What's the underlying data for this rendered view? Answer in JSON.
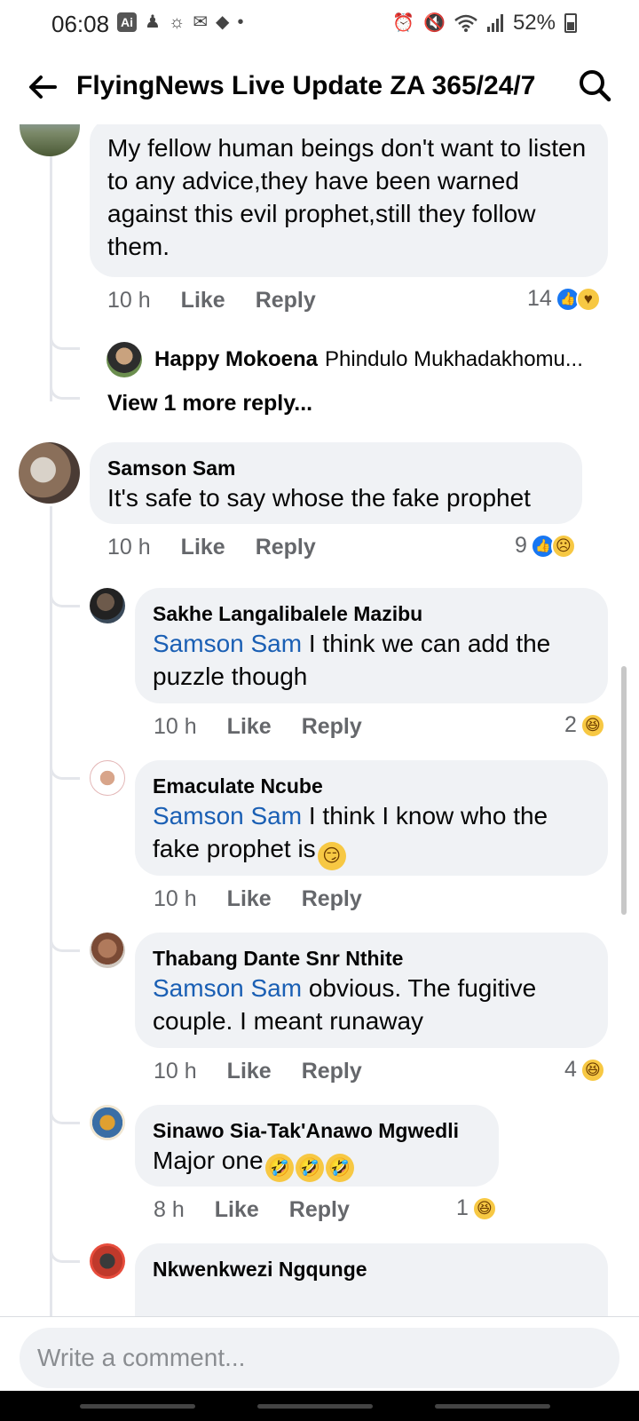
{
  "status_bar": {
    "time": "06:08",
    "ai_badge": "Ai",
    "battery": "52%",
    "left_icons": [
      "ai-icon",
      "person-icon",
      "weather-icon",
      "gmail-icon",
      "diamond-icon",
      "dot-icon"
    ],
    "right_icons": [
      "alarm-icon",
      "mute-icon",
      "wifi-icon",
      "signal-icon",
      "battery-icon"
    ]
  },
  "header": {
    "title": "FlyingNews Live Update ZA 365/24/7"
  },
  "colors": {
    "bubble": "#f0f2f5",
    "mention": "#1a5fb4",
    "like_blue": "#1877f2",
    "meta_gray": "#65676b"
  },
  "comments": [
    {
      "author": "",
      "text": "My fellow human beings don't want to listen to any advice,they have been warned against this evil prophet,still they follow them.",
      "time": "10 h",
      "like": "Like",
      "reply": "Reply",
      "reaction_count": "14",
      "reactions": [
        "like-icon",
        "care-icon"
      ],
      "reply_preview": {
        "author": "Happy Mokoena",
        "text": "Phindulo Mukhadakhomu..."
      },
      "view_more": "View 1 more reply..."
    },
    {
      "author": "Samson Sam",
      "text": "It's safe to say whose the fake prophet",
      "time": "10 h",
      "like": "Like",
      "reply": "Reply",
      "reaction_count": "9",
      "reactions": [
        "like-icon",
        "sad-icon"
      ]
    }
  ],
  "replies": [
    {
      "author": "Sakhe Langalibalele Mazibu",
      "mention": "Samson Sam",
      "text": " I think we can add the puzzle though",
      "time": "10 h",
      "like": "Like",
      "reply": "Reply",
      "reaction_count": "2",
      "reactions": [
        "haha-icon"
      ]
    },
    {
      "author": "Emaculate Ncube",
      "mention": "Samson Sam",
      "text": " I think I know who the fake prophet is",
      "emoji": "smirk-emoji",
      "time": "10 h",
      "like": "Like",
      "reply": "Reply",
      "reaction_count": "",
      "reactions": []
    },
    {
      "author": "Thabang Dante Snr Nthite",
      "mention": "Samson Sam",
      "text": " obvious. The fugitive couple. I meant runaway",
      "time": "10 h",
      "like": "Like",
      "reply": "Reply",
      "reaction_count": "4",
      "reactions": [
        "haha-icon"
      ]
    },
    {
      "author": "Sinawo Sia-Tak'Anawo Mgwedli",
      "text": "Major one",
      "emoji": "rofl-emoji",
      "time": "8 h",
      "like": "Like",
      "reply": "Reply",
      "reaction_count": "1",
      "reactions": [
        "haha-icon"
      ]
    },
    {
      "author": "Nkwenkwezi Ngqunge"
    }
  ],
  "composer": {
    "placeholder": "Write a comment..."
  }
}
